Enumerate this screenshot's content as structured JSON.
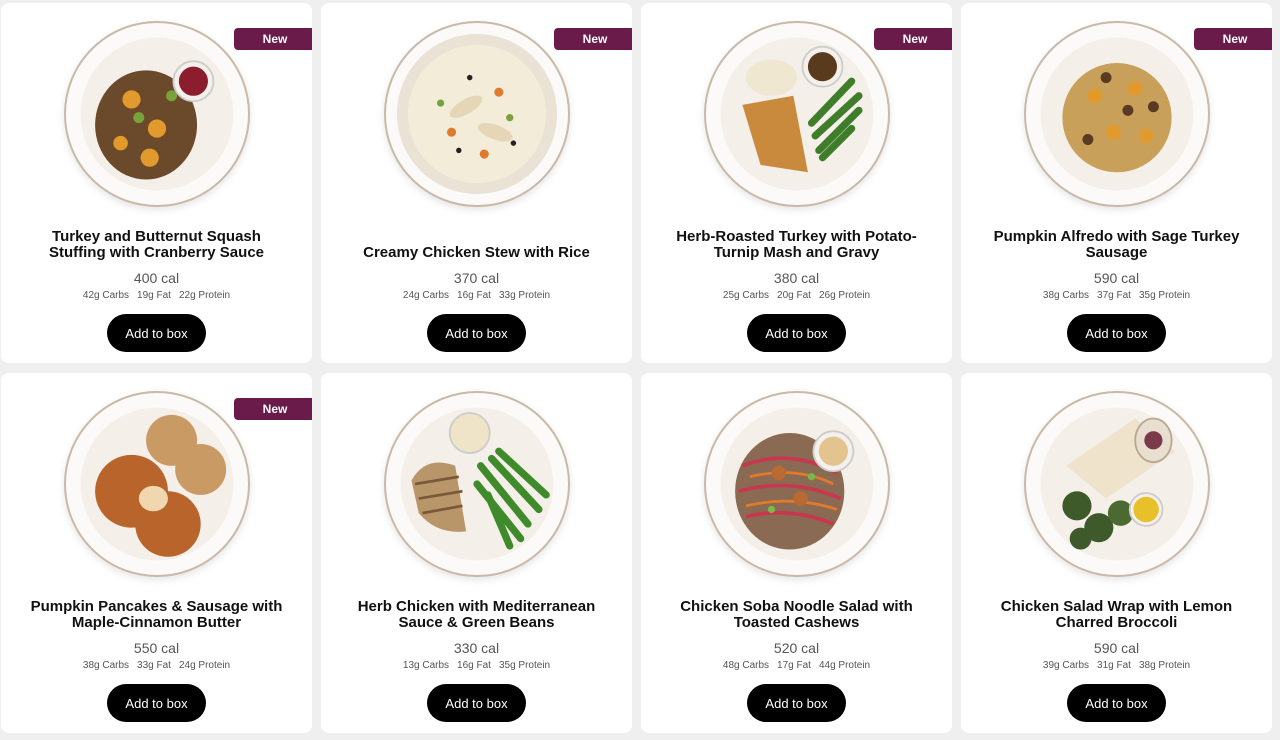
{
  "colors": {
    "badge": "#6a1b4a",
    "button": "#000000",
    "card": "#ffffff",
    "page": "#efefef"
  },
  "meals": [
    {
      "badge": "New",
      "title": "Turkey and Butternut Squash Stuffing with Cranberry Sauce",
      "calories": "400 cal",
      "carbs": "42g Carbs",
      "fat": "19g Fat",
      "protein": "22g Protein",
      "button": "Add to box",
      "image_icon": "stuffing-plate-icon"
    },
    {
      "badge": "New",
      "title": "Creamy Chicken Stew with Rice",
      "calories": "370 cal",
      "carbs": "24g Carbs",
      "fat": "16g Fat",
      "protein": "33g Protein",
      "button": "Add to box",
      "image_icon": "stew-bowl-icon"
    },
    {
      "badge": "New",
      "title": "Herb-Roasted Turkey with Potato-Turnip Mash and Gravy",
      "calories": "380 cal",
      "carbs": "25g Carbs",
      "fat": "20g Fat",
      "protein": "26g Protein",
      "button": "Add to box",
      "image_icon": "turkey-plate-icon"
    },
    {
      "badge": "New",
      "title": "Pumpkin Alfredo with Sage Turkey Sausage",
      "calories": "590 cal",
      "carbs": "38g Carbs",
      "fat": "37g Fat",
      "protein": "35g Protein",
      "button": "Add to box",
      "image_icon": "pasta-plate-icon"
    },
    {
      "badge": "New",
      "title": "Pumpkin Pancakes & Sausage with Maple-Cinnamon Butter",
      "calories": "550 cal",
      "carbs": "38g Carbs",
      "fat": "33g Fat",
      "protein": "24g Protein",
      "button": "Add to box",
      "image_icon": "pancake-plate-icon"
    },
    {
      "badge": "",
      "title": "Herb Chicken with Mediterranean Sauce & Green Beans",
      "calories": "330 cal",
      "carbs": "13g Carbs",
      "fat": "16g Fat",
      "protein": "35g Protein",
      "button": "Add to box",
      "image_icon": "chicken-beans-plate-icon"
    },
    {
      "badge": "",
      "title": "Chicken Soba Noodle Salad with Toasted Cashews",
      "calories": "520 cal",
      "carbs": "48g Carbs",
      "fat": "17g Fat",
      "protein": "44g Protein",
      "button": "Add to box",
      "image_icon": "soba-plate-icon"
    },
    {
      "badge": "",
      "title": "Chicken Salad Wrap with Lemon Charred Broccoli",
      "calories": "590 cal",
      "carbs": "39g Carbs",
      "fat": "31g Fat",
      "protein": "38g Protein",
      "button": "Add to box",
      "image_icon": "wrap-plate-icon"
    }
  ]
}
